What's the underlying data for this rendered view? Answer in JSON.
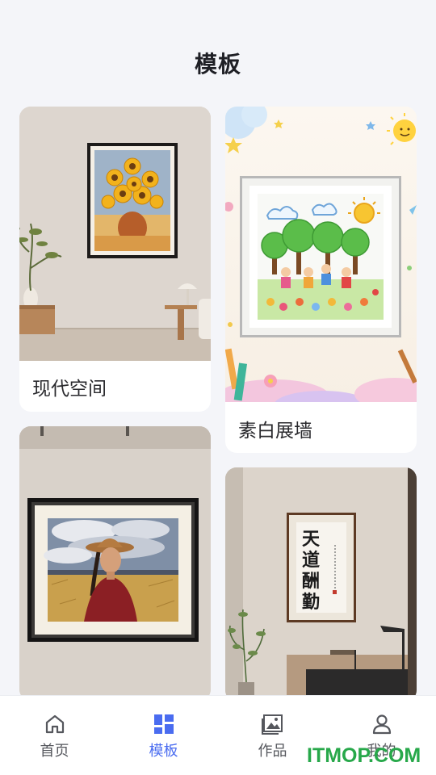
{
  "header": {
    "title": "模板"
  },
  "templates": [
    {
      "label": "现代空间"
    },
    {
      "label": "素白展墙"
    },
    {
      "label": ""
    },
    {
      "label": ""
    }
  ],
  "calligraphy": {
    "text": "天道酬勤"
  },
  "tabbar": {
    "items": [
      {
        "label": "首页",
        "icon": "home-icon",
        "active": false
      },
      {
        "label": "模板",
        "icon": "grid-icon",
        "active": true
      },
      {
        "label": "作品",
        "icon": "gallery-icon",
        "active": false
      },
      {
        "label": "我的",
        "icon": "user-icon",
        "active": false
      }
    ],
    "active_color": "#4a6cf0",
    "inactive_color": "#55575d"
  },
  "watermark": {
    "text": "ITMOP.COM",
    "color": "#27a84a"
  }
}
